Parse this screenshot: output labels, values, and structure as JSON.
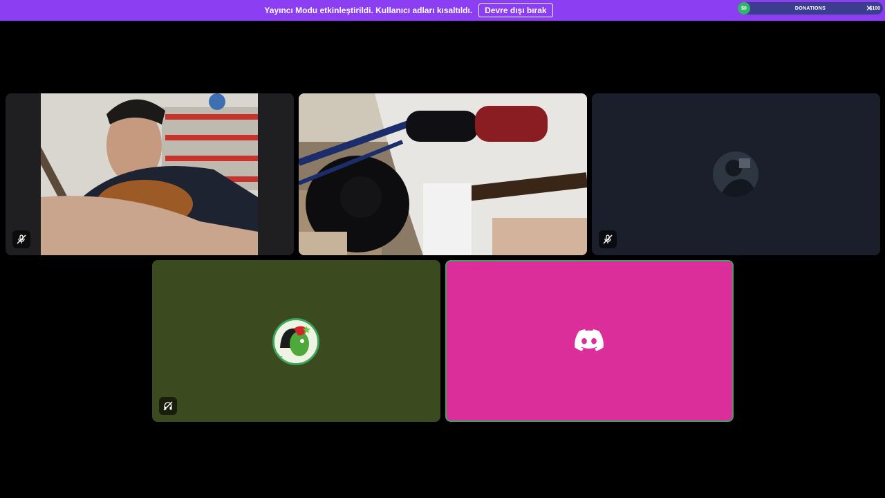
{
  "notice": {
    "text": "Yayıncı Modu etkinleştirildi. Kullanıcı adları kısaltıldı.",
    "button_label": "Devre dışı bırak",
    "background": "#8c3ef2"
  },
  "donations": {
    "start_label": "$0",
    "title": "DONATIONS",
    "goal_label": "$100",
    "progress": 0.0,
    "close_icon": "close-icon"
  },
  "tiles": [
    {
      "kind": "camera",
      "icon": "mic-muted-icon"
    },
    {
      "kind": "camera"
    },
    {
      "kind": "avatar",
      "icon": "mic-muted-icon"
    },
    {
      "kind": "avatar",
      "icon": "deafened-icon",
      "background": "#3c4a1f",
      "ring": "#3ba55c"
    },
    {
      "kind": "logo",
      "icon": "discord-icon",
      "background": "#dc2e9b",
      "border": "#3ba561"
    }
  ]
}
